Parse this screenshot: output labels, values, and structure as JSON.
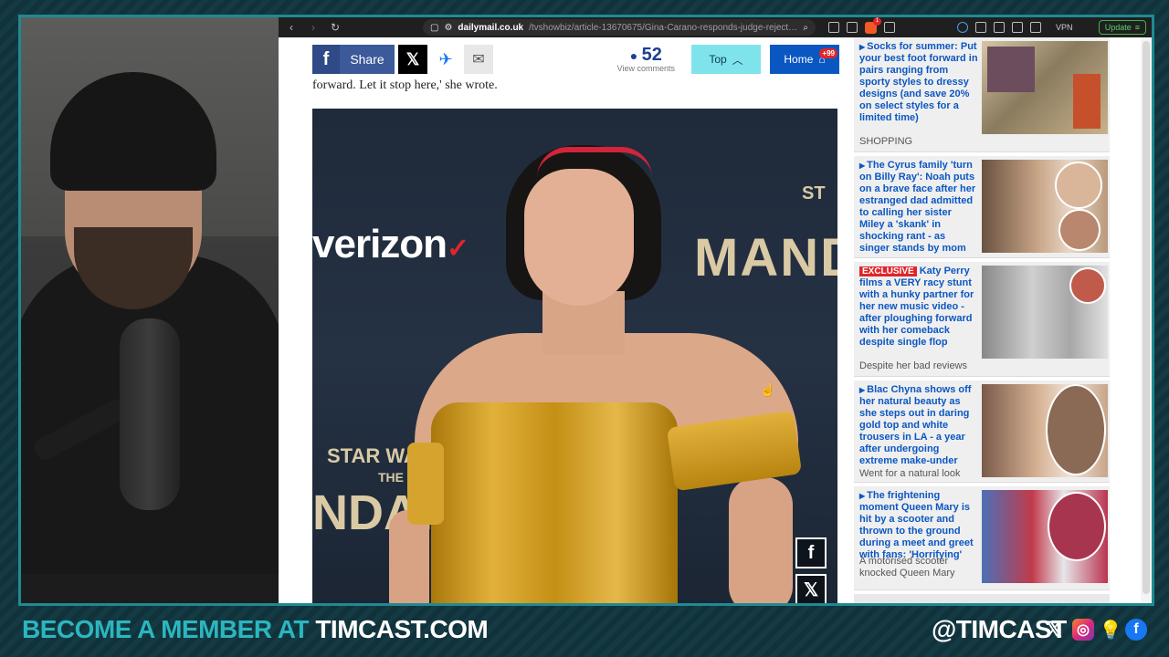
{
  "browser": {
    "url_host": "dailymail.co.uk",
    "url_path": "/tvshowbiz/article-13670675/Gina-Carano-responds-judge-rejects-Disneys-motio...",
    "vpn_label": "VPN",
    "update_label": "Update",
    "brave_badge": "1"
  },
  "sharebar": {
    "share_label": "Share",
    "comment_count": "52",
    "view_comments_label": "View comments",
    "top_label": "Top",
    "home_label": "Home",
    "home_badge": "+99"
  },
  "article": {
    "text_fragment": "forward. Let it stop here,' she wrote."
  },
  "hero_image": {
    "verizon_text": "verizon",
    "verizon_check": "✓",
    "mando_text": "MAND",
    "st_text": "ST",
    "starwars_text": "STAR WAR",
    "the_text": "THE",
    "ndar_text": "NDAR",
    "share_icons": [
      "facebook-icon",
      "x-icon"
    ]
  },
  "sidebar": {
    "items": [
      {
        "title": "Socks for summer: Put your best foot forward in pairs ranging from sporty styles to dressy designs (and save 20% on select styles for a limited time)",
        "subtitle": "SHOPPING"
      },
      {
        "title": "The Cyrus family 'turn on Billy Ray': Noah puts on a brave face after her estranged dad admitted to calling her sister Miley a 'skank' in shocking rant - as singer stands by mom",
        "subtitle": ""
      },
      {
        "badge": "EXCLUSIVE",
        "title": "Katy Perry films a VERY racy stunt with a hunky partner for her new music video - after ploughing forward with her comeback despite single flop",
        "subtitle": "Despite her bad reviews"
      },
      {
        "title": "Blac Chyna shows off her natural beauty as she steps out in daring gold top and white trousers in LA - a year after undergoing extreme make-under",
        "subtitle": "Went for a natural look"
      },
      {
        "title": "The frightening moment Queen Mary is hit by a scooter and thrown to the ground during a meet and greet with fans: 'Horrifying'",
        "subtitle": "A motorised scooter knocked Queen Mary"
      }
    ]
  },
  "overlay": {
    "member_text": "BECOME A MEMBER AT ",
    "member_site": "TIMCAST.COM",
    "handle": "@TIMCAST"
  },
  "colors": {
    "accent_teal": "#2bb6c0",
    "dm_blue": "#0b57c2",
    "fb_blue": "#3c5a99",
    "exclusive_red": "#e0252b"
  }
}
